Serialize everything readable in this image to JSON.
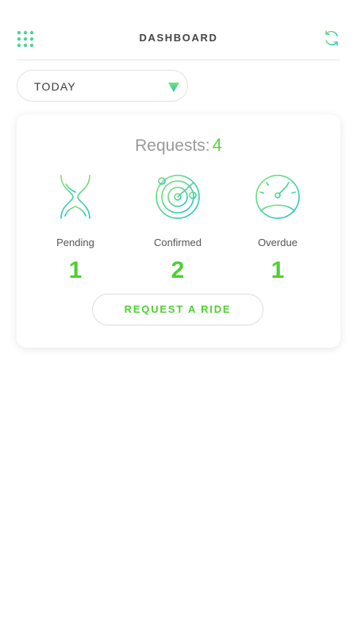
{
  "header": {
    "menu_icon": "grid-dots-icon",
    "title": "DASHBOARD",
    "refresh_icon": "refresh-icon"
  },
  "filter": {
    "period": "TODAY",
    "arrow_icon": "triangle-down-icon"
  },
  "summary": {
    "requests_label": "Requests:",
    "requests_count": "4",
    "stats": [
      {
        "label": "Pending",
        "value": "1",
        "icon": "hourglass-icon"
      },
      {
        "label": "Confirmed",
        "value": "2",
        "icon": "radar-icon"
      },
      {
        "label": "Overdue",
        "value": "1",
        "icon": "speedometer-icon"
      }
    ],
    "action_label": "REQUEST A RIDE"
  },
  "colors": {
    "accent_green": "#4fd031",
    "accent_teal": "#1ec3c8",
    "text_gray": "#9a9a9a"
  }
}
